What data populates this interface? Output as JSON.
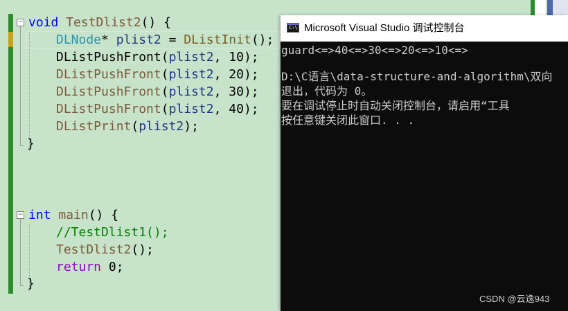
{
  "editor": {
    "code": {
      "line1": {
        "kw": "void",
        "fn": "TestDlist2",
        "rest": "() {"
      },
      "line2": {
        "type": "DLNode",
        "op": "* ",
        "var": "plist2",
        "mid": " = ",
        "fn": "DListInit",
        "rest": "();"
      },
      "line3": {
        "fn": "DListPushFront",
        "open": "(",
        "var": "plist2",
        "rest": ", 10);"
      },
      "line4": {
        "fn": "DListPushFront",
        "open": "(",
        "var": "plist2",
        "rest": ", 20);"
      },
      "line5": {
        "fn": "DListPushFront",
        "open": "(",
        "var": "plist2",
        "rest": ", 30);"
      },
      "line6": {
        "fn": "DListPushFront",
        "open": "(",
        "var": "plist2",
        "rest": ", 40);"
      },
      "line7": {
        "fn": "DListPrint",
        "open": "(",
        "var": "plist2",
        "rest": ");"
      },
      "line8": {
        "rest": "}"
      },
      "line9": {
        "kw": "int",
        "fn": "main",
        "rest": "() {"
      },
      "line10": {
        "comment": "//TestDlist1();"
      },
      "line11": {
        "fn": "TestDlist2",
        "rest": "();"
      },
      "line12": {
        "kw": "return",
        "rest": " 0;"
      },
      "line13": {
        "rest": "}"
      }
    },
    "fold_minus": "−"
  },
  "console": {
    "title": "Microsoft Visual Studio 调试控制台",
    "icon_text": "C:\\",
    "lines": [
      "guard<=>40<=>30<=>20<=>10<=>",
      "",
      "D:\\C语言\\data-structure-and-algorithm\\双向",
      "退出，代码为 0。",
      "要在调试停止时自动关闭控制台，请启用“工具",
      "按任意键关闭此窗口. . ."
    ]
  },
  "watermark": "CSDN @云逸943",
  "colors": {
    "editor_bg": "#c7e3ca",
    "keyword": "#0000ff",
    "type": "#2b91af",
    "function": "#795e26",
    "variable": "#1f377f",
    "comment": "#008000",
    "console_bg": "#0c0c0c",
    "console_text": "#cccccc"
  }
}
